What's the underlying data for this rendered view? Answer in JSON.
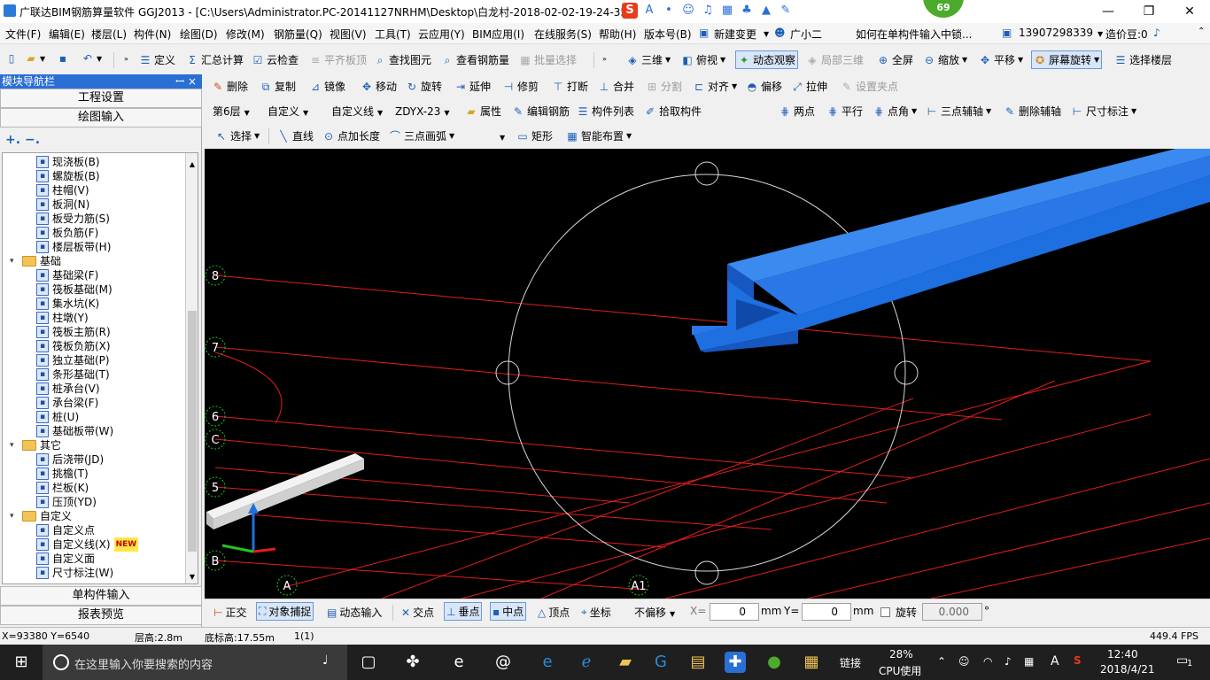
{
  "title": "广联达BIM钢筋算量软件 GGJ2013 - [C:\\Users\\Administrator.PC-20141127NRHM\\Desktop\\白龙村-2018-02-02-19-24-35",
  "ime_badge": "69",
  "window_controls": {
    "minimize": "—",
    "maximize": "❐",
    "close": "✕"
  },
  "menu": [
    "文件(F)",
    "编辑(E)",
    "楼层(L)",
    "构件(N)",
    "绘图(D)",
    "修改(M)",
    "钢筋量(Q)",
    "视图(V)",
    "工具(T)",
    "云应用(Y)",
    "BIM应用(I)",
    "在线服务(S)",
    "帮助(H)",
    "版本号(B)",
    "新建变更",
    "广小二"
  ],
  "menu_extra": {
    "hint": "如何在单构件输入中锁...",
    "phone": "13907298339",
    "price": "造价豆:0"
  },
  "toolbar1": {
    "items": [
      "定义",
      "汇总计算",
      "云检查",
      "平齐板顶",
      "查找图元",
      "查看钢筋量",
      "批量选择",
      "三维",
      "俯视",
      "动态观察",
      "局部三维",
      "全屏",
      "缩放",
      "平移",
      "屏幕旋转",
      "选择楼层"
    ]
  },
  "toolbar2": {
    "items": [
      "删除",
      "复制",
      "镜像",
      "移动",
      "旋转",
      "延伸",
      "修剪",
      "打断",
      "合并",
      "分割",
      "对齐",
      "偏移",
      "拉伸",
      "设置夹点"
    ]
  },
  "toolbar3": {
    "floor": "第6层",
    "type": "自定义",
    "subtype": "自定义线",
    "component": "ZDYX-23",
    "items": [
      "属性",
      "编辑钢筋",
      "构件列表",
      "拾取构件"
    ],
    "right_items": [
      "两点",
      "平行",
      "点角",
      "三点辅轴",
      "删除辅轴",
      "尺寸标注"
    ]
  },
  "toolbar4": {
    "items": [
      "选择",
      "直线",
      "点加长度",
      "三点画弧",
      "矩形",
      "智能布置"
    ]
  },
  "nav": {
    "header": "模块导航栏",
    "pin": "ꟷ",
    "close": "×",
    "btn_project": "工程设置",
    "btn_draw": "绘图输入",
    "btn_single": "单构件输入",
    "btn_report": "报表预览",
    "tree": [
      {
        "label": "现浇板(B)",
        "level": 2
      },
      {
        "label": "螺旋板(B)",
        "level": 2
      },
      {
        "label": "柱帽(V)",
        "level": 2
      },
      {
        "label": "板洞(N)",
        "level": 2
      },
      {
        "label": "板受力筋(S)",
        "level": 2
      },
      {
        "label": "板负筋(F)",
        "level": 2
      },
      {
        "label": "楼层板带(H)",
        "level": 2
      },
      {
        "label": "基础",
        "level": 1
      },
      {
        "label": "基础梁(F)",
        "level": 2
      },
      {
        "label": "筏板基础(M)",
        "level": 2
      },
      {
        "label": "集水坑(K)",
        "level": 2
      },
      {
        "label": "柱墩(Y)",
        "level": 2
      },
      {
        "label": "筏板主筋(R)",
        "level": 2
      },
      {
        "label": "筏板负筋(X)",
        "level": 2
      },
      {
        "label": "独立基础(P)",
        "level": 2
      },
      {
        "label": "条形基础(T)",
        "level": 2
      },
      {
        "label": "桩承台(V)",
        "level": 2
      },
      {
        "label": "承台梁(F)",
        "level": 2
      },
      {
        "label": "桩(U)",
        "level": 2
      },
      {
        "label": "基础板带(W)",
        "level": 2
      },
      {
        "label": "其它",
        "level": 1
      },
      {
        "label": "后浇带(JD)",
        "level": 2
      },
      {
        "label": "挑檐(T)",
        "level": 2
      },
      {
        "label": "栏板(K)",
        "level": 2
      },
      {
        "label": "压顶(YD)",
        "level": 2
      },
      {
        "label": "自定义",
        "level": 1
      },
      {
        "label": "自定义点",
        "level": 2
      },
      {
        "label": "自定义线(X)",
        "level": 2,
        "new": "NEW"
      },
      {
        "label": "自定义面",
        "level": 2
      },
      {
        "label": "尺寸标注(W)",
        "level": 2
      }
    ]
  },
  "grid_labels": {
    "rows": [
      "8",
      "7",
      "6",
      "C",
      "5",
      "B"
    ],
    "cols": [
      "A",
      "A1"
    ]
  },
  "bottom": {
    "items": [
      "正交",
      "对象捕捉",
      "动态输入",
      "交点",
      "垂点",
      "中点",
      "顶点",
      "坐标"
    ],
    "offset": "不偏移",
    "x_label": "X=",
    "x_value": "0",
    "x_unit": "mm",
    "y_label": "Y=",
    "y_value": "0",
    "y_unit": "mm",
    "rotate_label": "旋转",
    "rotate_value": "0.000",
    "deg": "°"
  },
  "status": {
    "coords": "X=93380 Y=6540",
    "floor_height": "层高:2.8m",
    "base_height": "底标高:17.55m",
    "count": "1(1)",
    "fps": "449.4 FPS"
  },
  "taskbar": {
    "search": "在这里输入你要搜索的内容",
    "link": "链接",
    "cpu_pct": "28%",
    "cpu_label": "CPU使用",
    "ime": "A",
    "time": "12:40",
    "date": "2018/4/21",
    "notif": "1"
  },
  "colors": {
    "accent": "#2a6fd6",
    "grid_red": "#e11d1d",
    "beam_blue": "#1e6fe0",
    "canvas_bg": "#000000"
  }
}
